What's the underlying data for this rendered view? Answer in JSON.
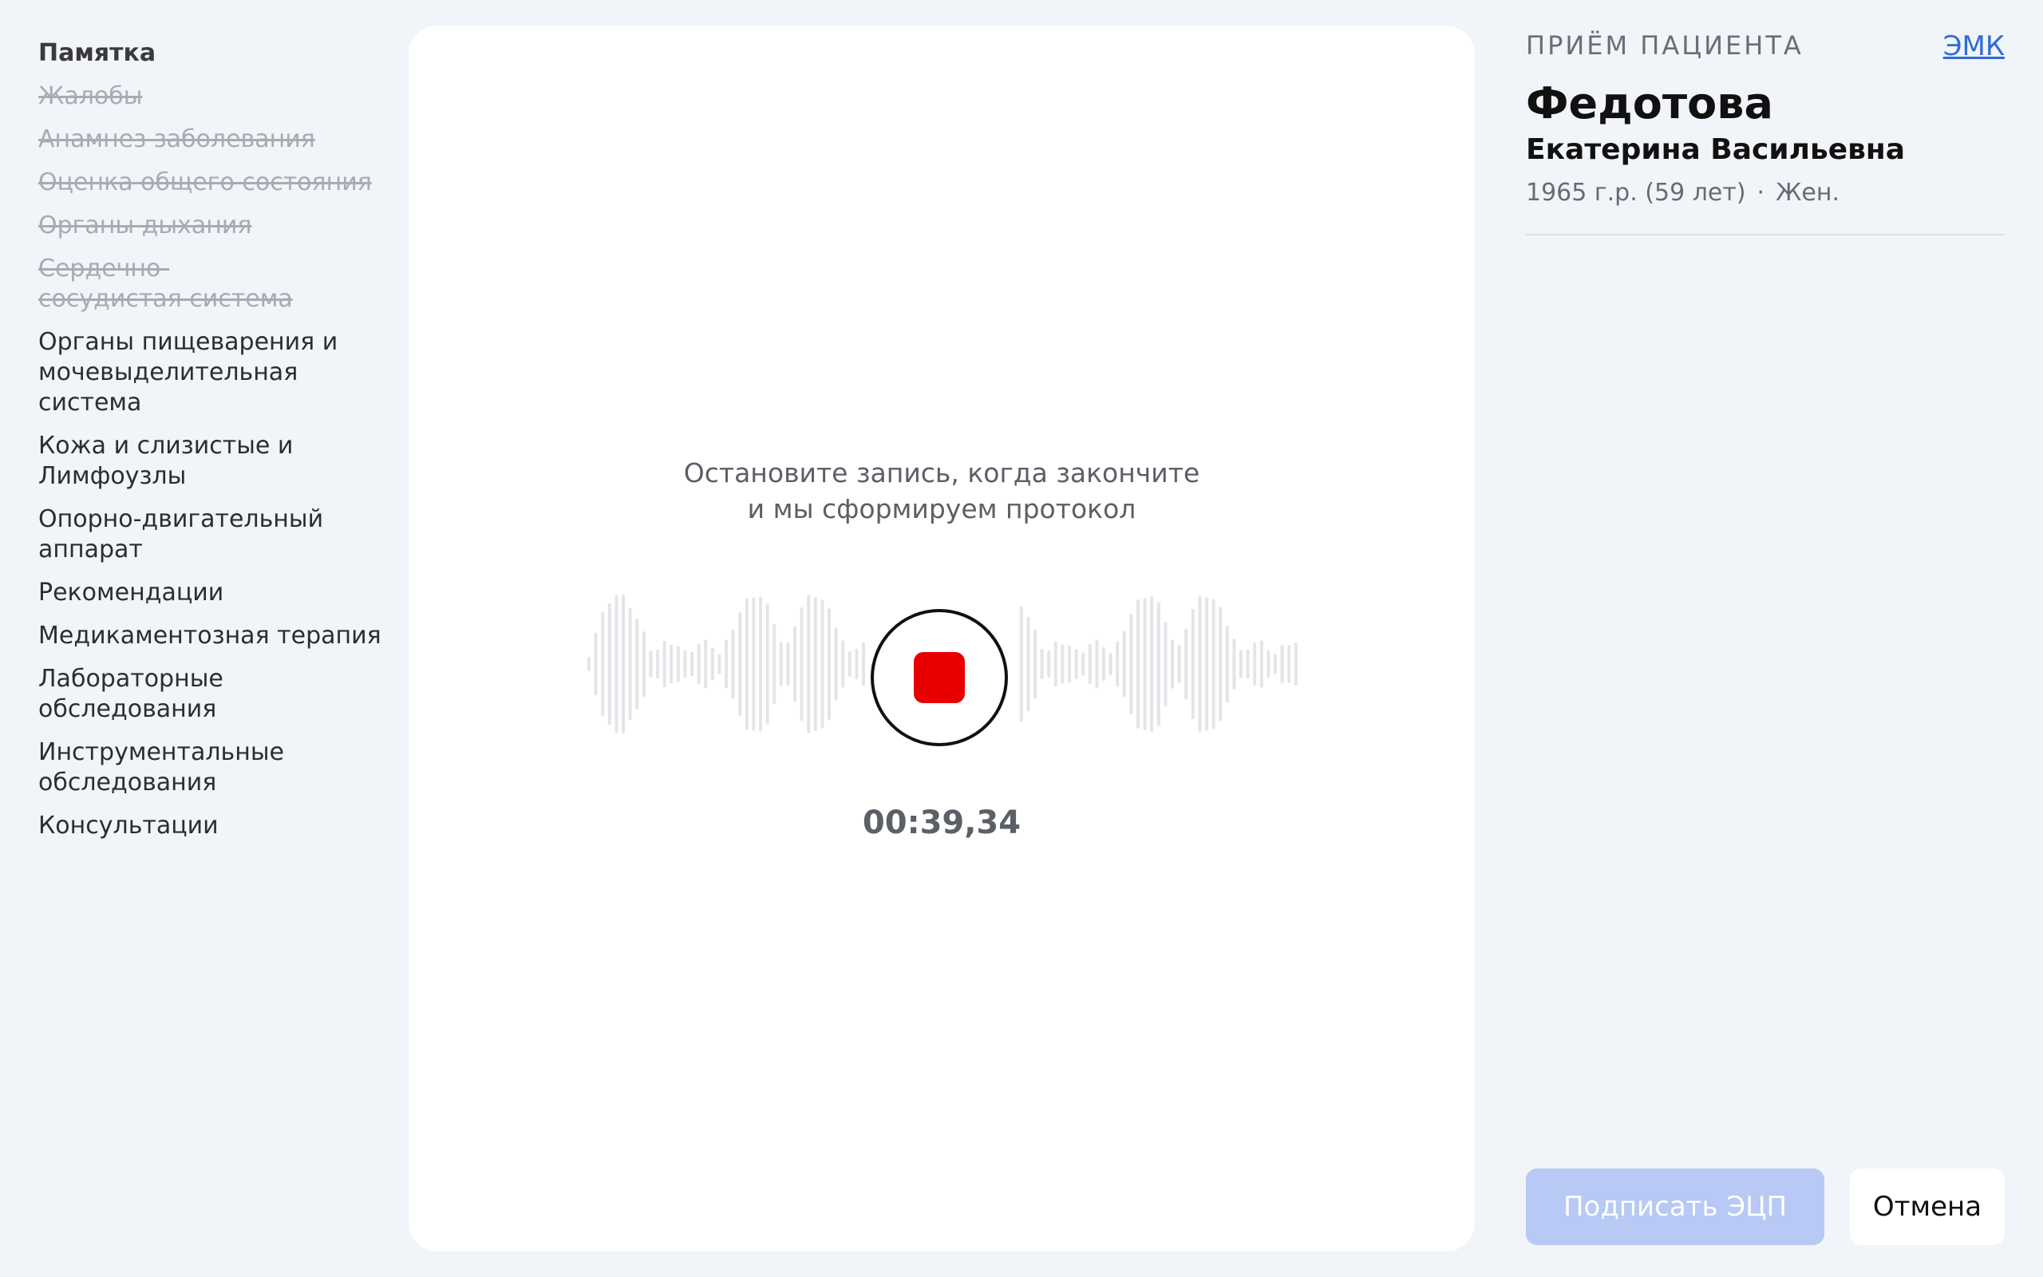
{
  "sidebar": {
    "items": [
      {
        "label": "Памятка",
        "state": "current"
      },
      {
        "label": "Жалобы",
        "state": "done"
      },
      {
        "label": "Анамнез заболевания",
        "state": "done"
      },
      {
        "label": "Оценка общего состояния",
        "state": "done"
      },
      {
        "label": "Органы дыхания",
        "state": "done"
      },
      {
        "label": "Сердечно-сосудистая система",
        "state": "done"
      },
      {
        "label": "Органы пищеварения и мочевыделительная система",
        "state": "pending"
      },
      {
        "label": "Кожа и слизистые и Лимфоузлы",
        "state": "pending"
      },
      {
        "label": "Опорно-двигательный аппарат",
        "state": "pending"
      },
      {
        "label": "Рекомендации",
        "state": "pending"
      },
      {
        "label": "Медикаментозная терапия",
        "state": "pending"
      },
      {
        "label": "Лабораторные обследования",
        "state": "pending"
      },
      {
        "label": "Инструментальные обследования",
        "state": "pending"
      },
      {
        "label": "Консультации",
        "state": "pending"
      }
    ]
  },
  "recorder": {
    "hint_line1": "Остановите запись, когда закончите",
    "hint_line2": "и мы сформируем протокол",
    "timer": "00:39,34",
    "stop_color": "#e80000"
  },
  "patient": {
    "section_label": "ПРИЁМ ПАЦИЕНТА",
    "emk_link": "ЭМК",
    "surname": "Федотова",
    "given_names": "Екатерина Васильевна",
    "birth": "1965 г.р. (59 лет)",
    "separator": "·",
    "sex": "Жен."
  },
  "actions": {
    "sign_label": "Подписать ЭЦП",
    "cancel_label": "Отмена"
  }
}
